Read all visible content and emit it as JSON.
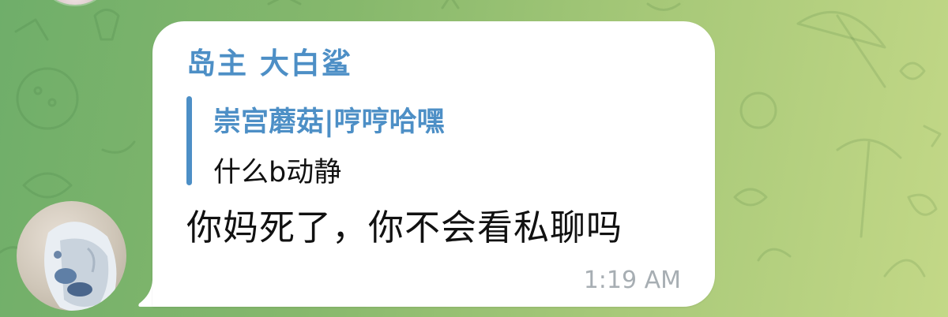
{
  "message": {
    "sender_name": "岛主 大白鲨",
    "reply": {
      "author": "崇宫蘑菇|哼哼哈嘿",
      "text": "什么b动静"
    },
    "text": "你妈死了，你不会看私聊吗",
    "time": "1:19 AM"
  },
  "colors": {
    "accent": "#4d8fc6",
    "bubble": "#ffffff",
    "timestamp": "#a7aeb3",
    "background_start": "#6fae6a",
    "background_end": "#c3d887"
  },
  "icons": {
    "avatar": "user-avatar",
    "previous_avatar": "user-avatar"
  }
}
